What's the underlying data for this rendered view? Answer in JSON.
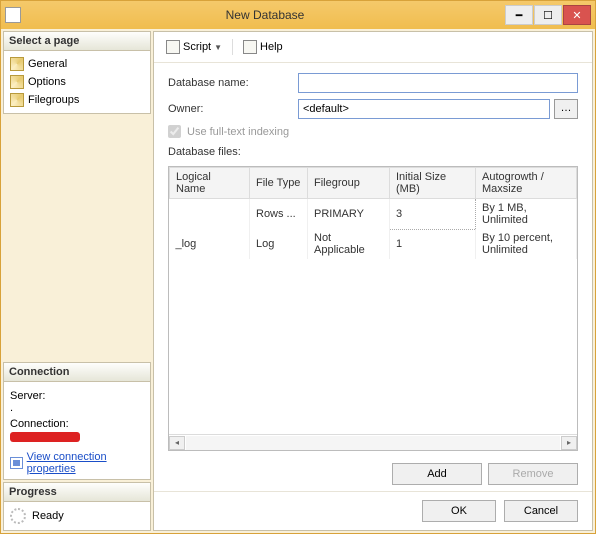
{
  "window": {
    "title": "New Database"
  },
  "select_page": {
    "header": "Select a page",
    "items": [
      {
        "label": "General"
      },
      {
        "label": "Options"
      },
      {
        "label": "Filegroups"
      }
    ]
  },
  "connection": {
    "header": "Connection",
    "server_label": "Server:",
    "server_value": ".",
    "connection_label": "Connection:",
    "view_props": "View connection properties"
  },
  "progress": {
    "header": "Progress",
    "status": "Ready"
  },
  "toolbar": {
    "script": "Script",
    "help": "Help"
  },
  "form": {
    "db_name_label": "Database name:",
    "db_name_value": "",
    "owner_label": "Owner:",
    "owner_value": "<default>",
    "fulltext_label": "Use full-text indexing",
    "files_label": "Database files:"
  },
  "grid": {
    "cols": [
      "Logical Name",
      "File Type",
      "Filegroup",
      "Initial Size (MB)",
      "Autogrowth / Maxsize"
    ],
    "rows": [
      {
        "name": "",
        "type": "Rows ...",
        "fg": "PRIMARY",
        "size": "3",
        "grow": "By 1 MB, Unlimited"
      },
      {
        "name": "_log",
        "type": "Log",
        "fg": "Not Applicable",
        "size": "1",
        "grow": "By 10 percent, Unlimited"
      }
    ]
  },
  "buttons": {
    "add": "Add",
    "remove": "Remove",
    "ok": "OK",
    "cancel": "Cancel"
  }
}
